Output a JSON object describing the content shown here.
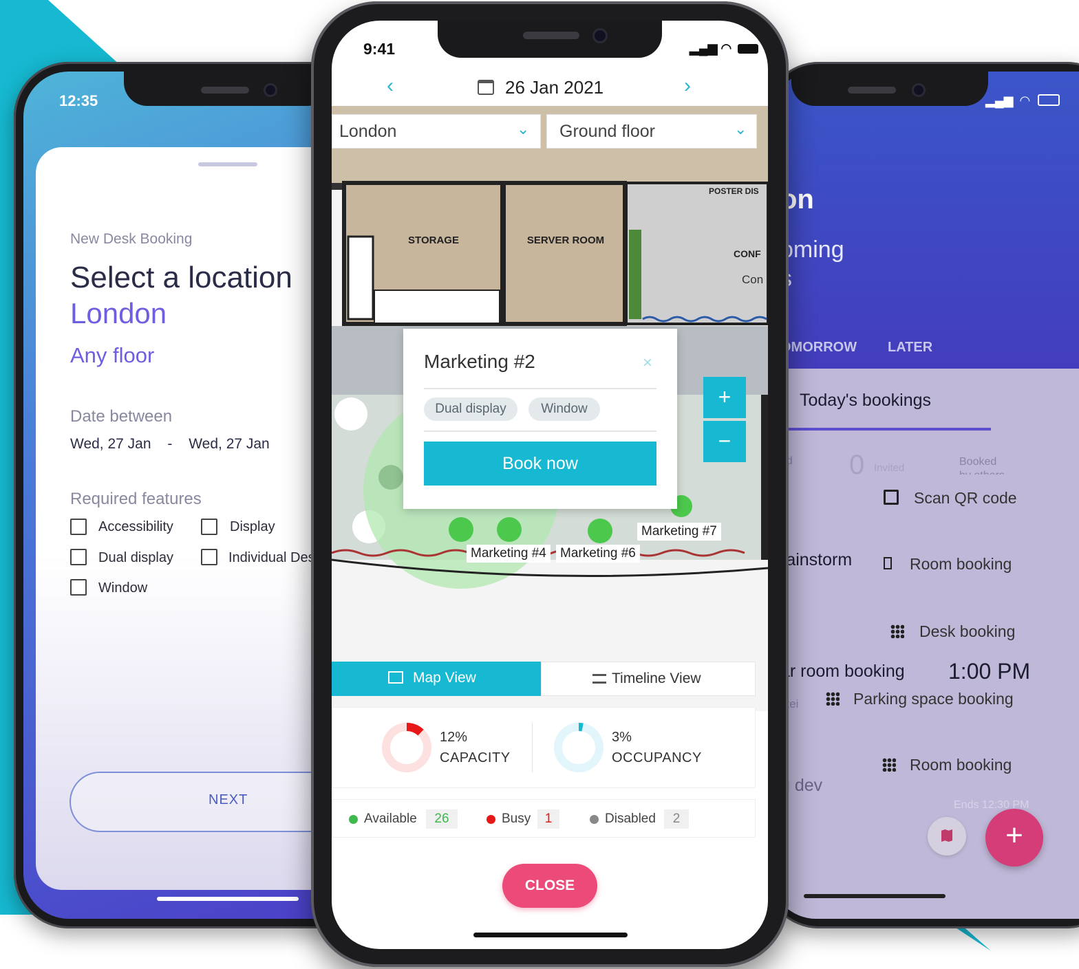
{
  "colors": {
    "teal": "#16b9d1",
    "accent_purple": "#6e5ee0",
    "pink_close": "#ec4a79",
    "fab_pink": "#d53d79"
  },
  "left": {
    "time": "12:35",
    "subtitle": "New Desk Booking",
    "title": "Select a location",
    "location": "London",
    "floor": "Any floor",
    "date_label": "Date between",
    "date_from": "Wed, 27 Jan",
    "date_sep": "-",
    "date_to": "Wed, 27 Jan",
    "features_label": "Required features",
    "features": [
      "Accessibility",
      "Display",
      "Dual display",
      "Individual Desk",
      "Window"
    ],
    "next": "NEXT"
  },
  "center": {
    "time": "9:41",
    "date": "26 Jan 2021",
    "location": "London",
    "floor": "Ground floor",
    "rooms": [
      "STORAGE",
      "SERVER ROOM",
      "POSTER DIS",
      "CONF",
      "Con"
    ],
    "popup": {
      "title": "Marketing #2",
      "chips": [
        "Dual display",
        "Window"
      ],
      "book": "Book now"
    },
    "zoom_in": "+",
    "zoom_out": "−",
    "desk_labels": [
      "Marketing #4",
      "Marketing #6",
      "Marketing #7"
    ],
    "tabs": {
      "map": "Map View",
      "timeline": "Timeline View"
    },
    "capacity": {
      "value": 12,
      "pct": "12%",
      "label": "CAPACITY"
    },
    "occupancy": {
      "value": 3,
      "pct": "3%",
      "label": "OCCUPANCY"
    },
    "legend": [
      {
        "label": "Available",
        "count": "26",
        "color": "#3fb94d"
      },
      {
        "label": "Busy",
        "count": "1",
        "color": "#e81818"
      },
      {
        "label": "Disabled",
        "count": "2",
        "color": "#888888"
      }
    ],
    "close": "CLOSE"
  },
  "right": {
    "title_partial": "on",
    "sub1": "oming",
    "sub2": "s",
    "tabs": [
      "OMORROW",
      "LATER"
    ],
    "todays": "Today's bookings",
    "stat_left": "ed\ne",
    "invited_count": "0",
    "invited": "Invited",
    "booked_others": "Booked\nby others",
    "row1": "rainstorm",
    "row2": "ar room booking",
    "row2_time": "1:00 PM",
    "row2_sub": "stei",
    "row3": "g dev",
    "row3_sub": "Ends 12:30 PM",
    "actions": [
      "Scan QR code",
      "Room booking",
      "Desk booking",
      "Parking space booking",
      "Room booking"
    ],
    "fab": "+"
  }
}
